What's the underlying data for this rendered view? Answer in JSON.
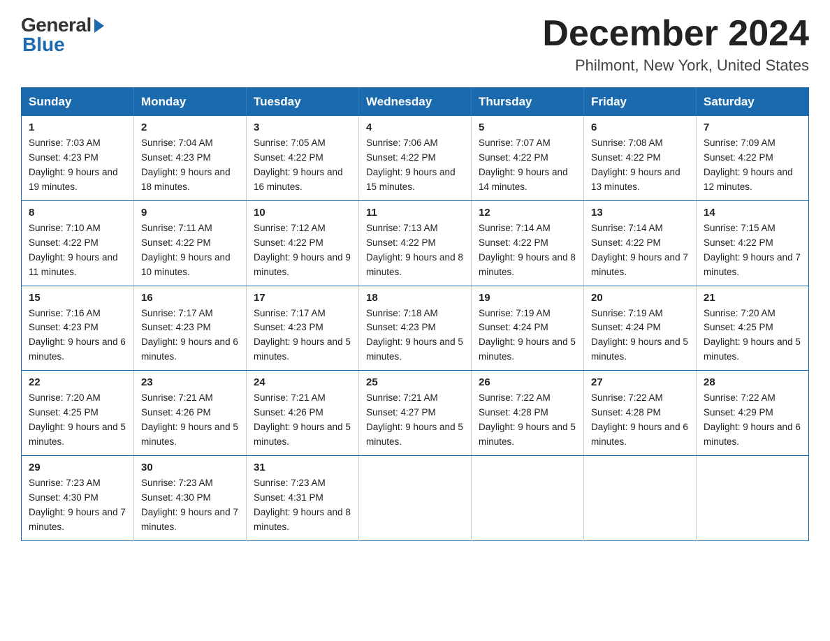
{
  "header": {
    "logo_general": "General",
    "logo_blue": "Blue",
    "month_year": "December 2024",
    "location": "Philmont, New York, United States"
  },
  "days_of_week": [
    "Sunday",
    "Monday",
    "Tuesday",
    "Wednesday",
    "Thursday",
    "Friday",
    "Saturday"
  ],
  "weeks": [
    [
      {
        "num": "1",
        "sunrise": "7:03 AM",
        "sunset": "4:23 PM",
        "daylight": "9 hours and 19 minutes."
      },
      {
        "num": "2",
        "sunrise": "7:04 AM",
        "sunset": "4:23 PM",
        "daylight": "9 hours and 18 minutes."
      },
      {
        "num": "3",
        "sunrise": "7:05 AM",
        "sunset": "4:22 PM",
        "daylight": "9 hours and 16 minutes."
      },
      {
        "num": "4",
        "sunrise": "7:06 AM",
        "sunset": "4:22 PM",
        "daylight": "9 hours and 15 minutes."
      },
      {
        "num": "5",
        "sunrise": "7:07 AM",
        "sunset": "4:22 PM",
        "daylight": "9 hours and 14 minutes."
      },
      {
        "num": "6",
        "sunrise": "7:08 AM",
        "sunset": "4:22 PM",
        "daylight": "9 hours and 13 minutes."
      },
      {
        "num": "7",
        "sunrise": "7:09 AM",
        "sunset": "4:22 PM",
        "daylight": "9 hours and 12 minutes."
      }
    ],
    [
      {
        "num": "8",
        "sunrise": "7:10 AM",
        "sunset": "4:22 PM",
        "daylight": "9 hours and 11 minutes."
      },
      {
        "num": "9",
        "sunrise": "7:11 AM",
        "sunset": "4:22 PM",
        "daylight": "9 hours and 10 minutes."
      },
      {
        "num": "10",
        "sunrise": "7:12 AM",
        "sunset": "4:22 PM",
        "daylight": "9 hours and 9 minutes."
      },
      {
        "num": "11",
        "sunrise": "7:13 AM",
        "sunset": "4:22 PM",
        "daylight": "9 hours and 8 minutes."
      },
      {
        "num": "12",
        "sunrise": "7:14 AM",
        "sunset": "4:22 PM",
        "daylight": "9 hours and 8 minutes."
      },
      {
        "num": "13",
        "sunrise": "7:14 AM",
        "sunset": "4:22 PM",
        "daylight": "9 hours and 7 minutes."
      },
      {
        "num": "14",
        "sunrise": "7:15 AM",
        "sunset": "4:22 PM",
        "daylight": "9 hours and 7 minutes."
      }
    ],
    [
      {
        "num": "15",
        "sunrise": "7:16 AM",
        "sunset": "4:23 PM",
        "daylight": "9 hours and 6 minutes."
      },
      {
        "num": "16",
        "sunrise": "7:17 AM",
        "sunset": "4:23 PM",
        "daylight": "9 hours and 6 minutes."
      },
      {
        "num": "17",
        "sunrise": "7:17 AM",
        "sunset": "4:23 PM",
        "daylight": "9 hours and 5 minutes."
      },
      {
        "num": "18",
        "sunrise": "7:18 AM",
        "sunset": "4:23 PM",
        "daylight": "9 hours and 5 minutes."
      },
      {
        "num": "19",
        "sunrise": "7:19 AM",
        "sunset": "4:24 PM",
        "daylight": "9 hours and 5 minutes."
      },
      {
        "num": "20",
        "sunrise": "7:19 AM",
        "sunset": "4:24 PM",
        "daylight": "9 hours and 5 minutes."
      },
      {
        "num": "21",
        "sunrise": "7:20 AM",
        "sunset": "4:25 PM",
        "daylight": "9 hours and 5 minutes."
      }
    ],
    [
      {
        "num": "22",
        "sunrise": "7:20 AM",
        "sunset": "4:25 PM",
        "daylight": "9 hours and 5 minutes."
      },
      {
        "num": "23",
        "sunrise": "7:21 AM",
        "sunset": "4:26 PM",
        "daylight": "9 hours and 5 minutes."
      },
      {
        "num": "24",
        "sunrise": "7:21 AM",
        "sunset": "4:26 PM",
        "daylight": "9 hours and 5 minutes."
      },
      {
        "num": "25",
        "sunrise": "7:21 AM",
        "sunset": "4:27 PM",
        "daylight": "9 hours and 5 minutes."
      },
      {
        "num": "26",
        "sunrise": "7:22 AM",
        "sunset": "4:28 PM",
        "daylight": "9 hours and 5 minutes."
      },
      {
        "num": "27",
        "sunrise": "7:22 AM",
        "sunset": "4:28 PM",
        "daylight": "9 hours and 6 minutes."
      },
      {
        "num": "28",
        "sunrise": "7:22 AM",
        "sunset": "4:29 PM",
        "daylight": "9 hours and 6 minutes."
      }
    ],
    [
      {
        "num": "29",
        "sunrise": "7:23 AM",
        "sunset": "4:30 PM",
        "daylight": "9 hours and 7 minutes."
      },
      {
        "num": "30",
        "sunrise": "7:23 AM",
        "sunset": "4:30 PM",
        "daylight": "9 hours and 7 minutes."
      },
      {
        "num": "31",
        "sunrise": "7:23 AM",
        "sunset": "4:31 PM",
        "daylight": "9 hours and 8 minutes."
      },
      null,
      null,
      null,
      null
    ]
  ]
}
